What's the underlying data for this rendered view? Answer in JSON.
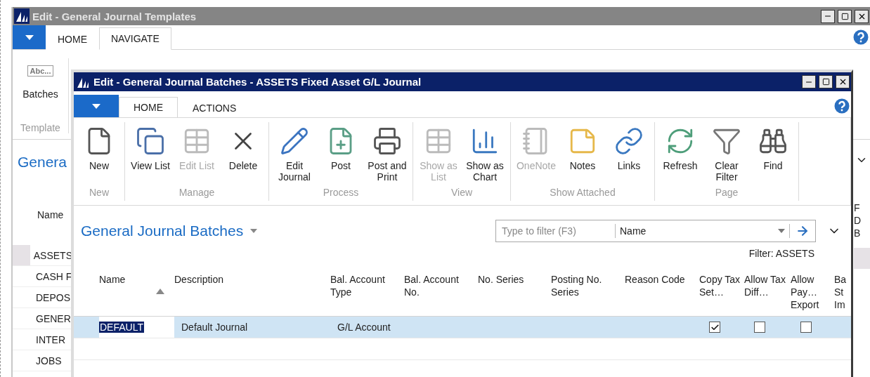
{
  "outer_window": {
    "title": "Edit - General Journal Templates",
    "tabs": [
      {
        "label": "HOME",
        "selected": false
      },
      {
        "label": "NAVIGATE",
        "selected": true
      }
    ],
    "ribbon": {
      "icon_text": "Abc...",
      "action": "Batches",
      "group": "Template"
    },
    "page_title": "Genera",
    "table": {
      "column_1": "Name",
      "column_2": "F D B",
      "rows": [
        {
          "name": "ASSETS",
          "selected": true
        },
        {
          "name": "CASH F",
          "selected": false
        },
        {
          "name": "DEPOS",
          "selected": false
        },
        {
          "name": "GENER",
          "selected": false
        },
        {
          "name": "INTER",
          "selected": false
        },
        {
          "name": "JOBS",
          "selected": false
        }
      ]
    }
  },
  "inner_window": {
    "title": "Edit - General Journal Batches - ASSETS Fixed Asset G/L Journal",
    "tabs": [
      {
        "label": "HOME",
        "selected": true
      },
      {
        "label": "ACTIONS",
        "selected": false
      }
    ],
    "ribbon": [
      {
        "group": "New",
        "actions": [
          {
            "label": "New",
            "disabled": false
          }
        ]
      },
      {
        "group": "Manage",
        "actions": [
          {
            "label": "View List",
            "disabled": false
          },
          {
            "label": "Edit List",
            "disabled": true
          },
          {
            "label": "Delete",
            "disabled": false
          }
        ]
      },
      {
        "group": "Process",
        "actions": [
          {
            "label": "Edit Journal",
            "disabled": false
          },
          {
            "label": "Post",
            "disabled": false
          },
          {
            "label": "Post and Print",
            "disabled": false
          }
        ]
      },
      {
        "group": "View",
        "actions": [
          {
            "label": "Show as List",
            "disabled": true
          },
          {
            "label": "Show as Chart",
            "disabled": false
          }
        ]
      },
      {
        "group": "Show Attached",
        "actions": [
          {
            "label": "OneNote",
            "disabled": true
          },
          {
            "label": "Notes",
            "disabled": false
          },
          {
            "label": "Links",
            "disabled": false
          }
        ]
      },
      {
        "group": "Page",
        "actions": [
          {
            "label": "Refresh",
            "disabled": false
          },
          {
            "label": "Clear Filter",
            "disabled": false
          },
          {
            "label": "Find",
            "disabled": false
          }
        ]
      }
    ],
    "page_title": "General Journal Batches",
    "filter": {
      "placeholder": "Type to filter (F3)",
      "field": "Name"
    },
    "filter_status": "Filter: ASSETS",
    "columns": [
      {
        "label": "Name",
        "sorted": true
      },
      {
        "label": "Description",
        "sorted": false
      },
      {
        "label": "Bal. Account Type",
        "sorted": false
      },
      {
        "label": "Bal. Account No.",
        "sorted": false
      },
      {
        "label": "No. Series",
        "sorted": false
      },
      {
        "label": "Posting No. Series",
        "sorted": false
      },
      {
        "label": "Reason Code",
        "sorted": false
      },
      {
        "label": "Copy Tax Set…",
        "sorted": false
      },
      {
        "label": "Allow Tax Diff…",
        "sorted": false
      },
      {
        "label": "Allow Pay… Export",
        "sorted": false
      },
      {
        "label": "Ba St Im",
        "sorted": false
      }
    ],
    "rows": [
      {
        "selected": true,
        "name": "DEFAULT",
        "description": "Default Journal",
        "bal_account_type": "G/L Account",
        "checks": [
          {
            "checked": true
          },
          {
            "checked": false
          },
          {
            "checked": false
          }
        ]
      }
    ]
  }
}
